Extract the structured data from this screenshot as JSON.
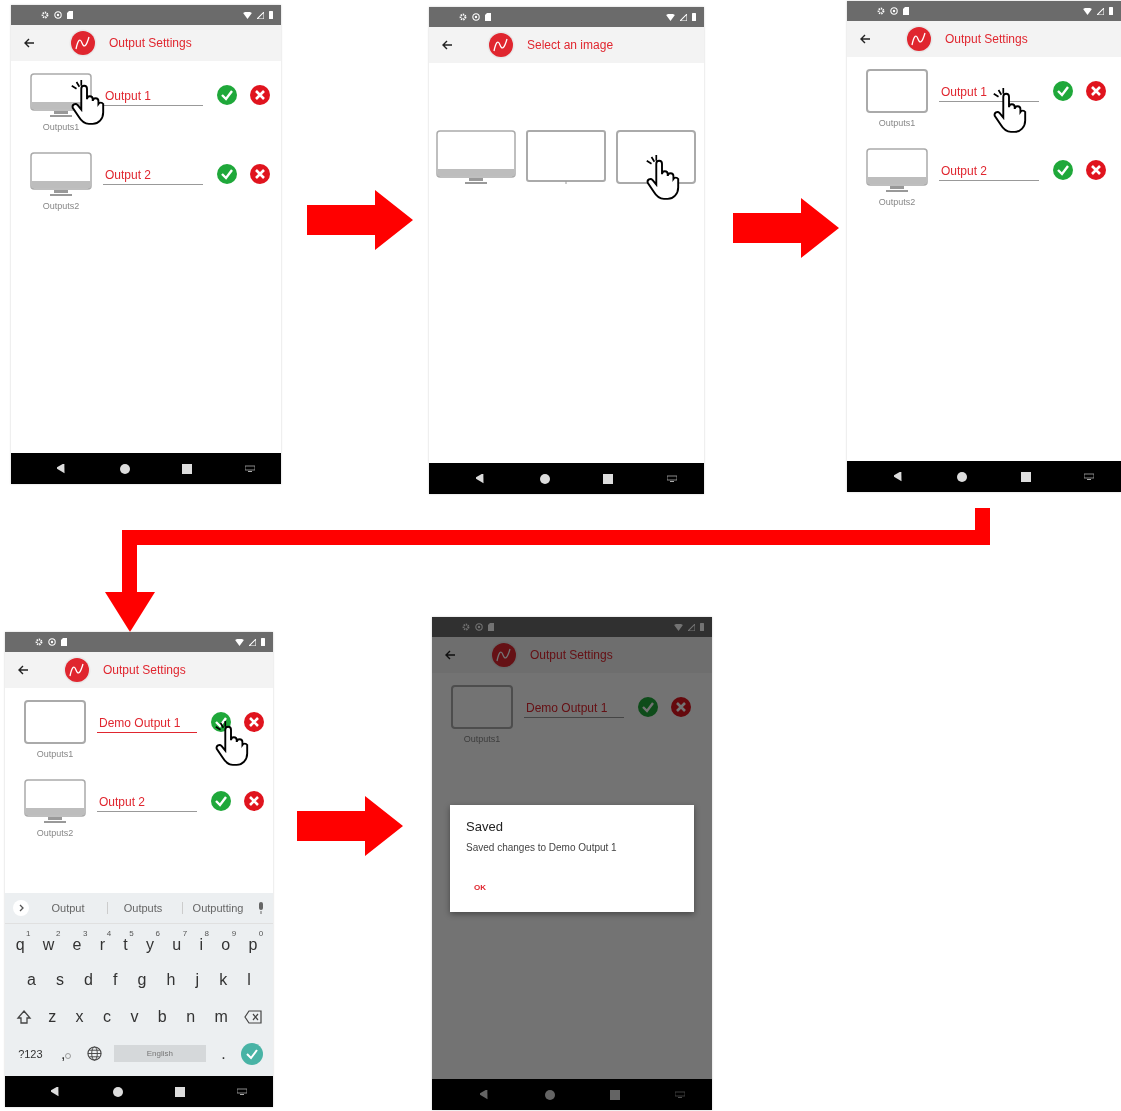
{
  "screens": [
    {
      "kind": "settings",
      "title": "Output Settings",
      "outputs": [
        {
          "kind": "monitor",
          "caption": "Outputs1",
          "name": "Output 1",
          "focused": false,
          "image_tapped": true,
          "name_tapped": false,
          "save_tapped": false
        },
        {
          "kind": "monitor",
          "caption": "Outputs2",
          "name": "Output 2",
          "focused": false,
          "image_tapped": false,
          "name_tapped": false,
          "save_tapped": false
        }
      ]
    },
    {
      "kind": "picker",
      "title": "Select an image",
      "images": [
        {
          "kind": "monitor",
          "tapped": false
        },
        {
          "kind": "tv",
          "tapped": false
        },
        {
          "kind": "frame",
          "tapped": true
        }
      ]
    },
    {
      "kind": "settings",
      "title": "Output Settings",
      "outputs": [
        {
          "kind": "frame",
          "caption": "Outputs1",
          "name": "Output 1",
          "focused": false,
          "image_tapped": false,
          "name_tapped": true,
          "save_tapped": false
        },
        {
          "kind": "monitor",
          "caption": "Outputs2",
          "name": "Output 2",
          "focused": false,
          "image_tapped": false,
          "name_tapped": false,
          "save_tapped": false
        }
      ]
    },
    {
      "kind": "settings",
      "title": "Output Settings",
      "outputs": [
        {
          "kind": "frame",
          "caption": "Outputs1",
          "name": "Demo Output 1",
          "focused": true,
          "image_tapped": false,
          "name_tapped": false,
          "save_tapped": true
        },
        {
          "kind": "monitor",
          "caption": "Outputs2",
          "name": "Output 2",
          "focused": false,
          "image_tapped": false,
          "name_tapped": false,
          "save_tapped": false
        }
      ],
      "keyboard": {
        "suggestions": [
          "Output",
          "Outputs",
          "Outputting"
        ],
        "key_rows": [
          {
            "keys": [
              {
                "kind": "text",
                "label": "q",
                "hint": "1"
              },
              {
                "kind": "text",
                "label": "w",
                "hint": "2"
              },
              {
                "kind": "text",
                "label": "e",
                "hint": "3"
              },
              {
                "kind": "text",
                "label": "r",
                "hint": "4"
              },
              {
                "kind": "text",
                "label": "t",
                "hint": "5"
              },
              {
                "kind": "text",
                "label": "y",
                "hint": "6"
              },
              {
                "kind": "text",
                "label": "u",
                "hint": "7"
              },
              {
                "kind": "text",
                "label": "i",
                "hint": "8"
              },
              {
                "kind": "text",
                "label": "o",
                "hint": "9"
              },
              {
                "kind": "text",
                "label": "p",
                "hint": "0"
              }
            ]
          },
          {
            "keys": [
              {
                "kind": "text",
                "label": "a"
              },
              {
                "kind": "text",
                "label": "s"
              },
              {
                "kind": "text",
                "label": "d"
              },
              {
                "kind": "text",
                "label": "f"
              },
              {
                "kind": "text",
                "label": "g"
              },
              {
                "kind": "text",
                "label": "h"
              },
              {
                "kind": "text",
                "label": "j"
              },
              {
                "kind": "text",
                "label": "k"
              },
              {
                "kind": "text",
                "label": "l"
              }
            ]
          },
          {
            "keys": [
              {
                "kind": "shift"
              },
              {
                "kind": "text",
                "label": "z"
              },
              {
                "kind": "text",
                "label": "x"
              },
              {
                "kind": "text",
                "label": "c"
              },
              {
                "kind": "text",
                "label": "v"
              },
              {
                "kind": "text",
                "label": "b"
              },
              {
                "kind": "text",
                "label": "n"
              },
              {
                "kind": "text",
                "label": "m"
              },
              {
                "kind": "backspace"
              }
            ]
          },
          {
            "keys": [
              {
                "kind": "text",
                "label": "?123"
              },
              {
                "kind": "emoji",
                "label": ","
              },
              {
                "kind": "globe"
              },
              {
                "kind": "space",
                "label": "English"
              },
              {
                "kind": "text",
                "label": "."
              },
              {
                "kind": "enter"
              }
            ]
          }
        ]
      }
    },
    {
      "kind": "settings",
      "title": "Output Settings",
      "outputs": [
        {
          "kind": "frame",
          "caption": "Outputs1",
          "name": "Demo Output 1",
          "focused": false,
          "image_tapped": false,
          "name_tapped": false,
          "save_tapped": false
        }
      ],
      "dialog": {
        "title": "Saved",
        "message": "Saved changes to Demo Output 1",
        "button": "OK"
      }
    }
  ]
}
